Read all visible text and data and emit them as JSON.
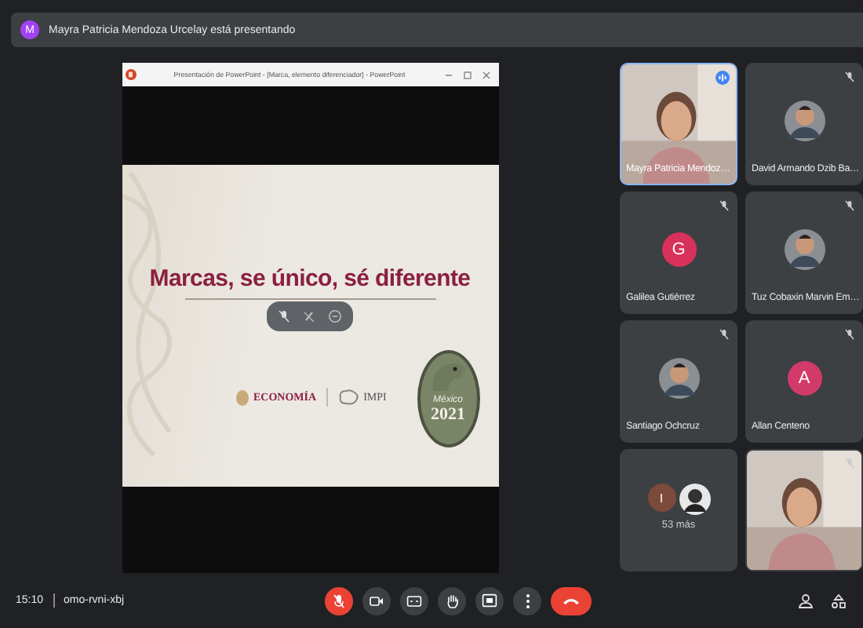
{
  "presenting_banner": {
    "avatar_letter": "M",
    "text": "Mayra Patricia Mendoza Urcelay está presentando"
  },
  "presentation": {
    "window_title": "Presentación de PowerPoint - [Marca, elemento diferenciador] - PowerPoint",
    "slide": {
      "title": "Marcas, se único, sé diferente",
      "logos": [
        "ECONOMÍA",
        "IMPI"
      ],
      "seal_label": "México",
      "seal_year": "2021"
    }
  },
  "participants": [
    {
      "kind": "video",
      "name": "Mayra Patricia Mendoz…",
      "speaking": true,
      "muted": false
    },
    {
      "name": "David Armando Dzib Ba…",
      "speaking": false,
      "muted": true
    },
    {
      "kind": "letter",
      "name": "Galilea Gutiérrez",
      "letter": "G",
      "color": "#d8315b",
      "speaking": false,
      "muted": true
    },
    {
      "name": "Tuz Cobaxin Marvin Em…",
      "speaking": false,
      "muted": true
    },
    {
      "name": "Santiago Ochcruz",
      "speaking": false,
      "muted": true
    },
    {
      "kind": "letter",
      "name": "Allan Centeno",
      "letter": "A",
      "color": "#d23a6a",
      "speaking": false,
      "muted": true
    },
    {
      "kind": "more",
      "letter": "I",
      "color": "#7b4a3a",
      "label": "53 más",
      "speaking": false,
      "muted": false
    },
    {
      "kind": "video",
      "speaking": false,
      "muted": true
    }
  ],
  "bottom_bar": {
    "time": "15:10",
    "meeting_code": "omo-rvni-xbj",
    "controls": [
      {
        "kind": "mic",
        "on": false
      },
      {
        "kind": "camera",
        "on": true
      },
      {
        "kind": "captions",
        "on": true
      },
      {
        "kind": "hand",
        "on": true
      },
      {
        "kind": "present",
        "on": true
      },
      {
        "kind": "more",
        "on": true
      },
      {
        "kind": "hangup",
        "on": true
      }
    ]
  }
}
